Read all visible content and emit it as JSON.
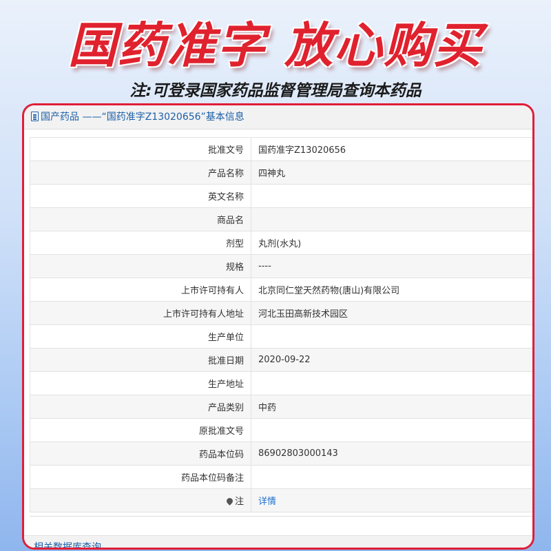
{
  "banner": {
    "title": "国药准字 放心购买",
    "notice": "注:可登录国家药品监督管理局查询本药品"
  },
  "panel": {
    "icon": "document-icon",
    "title": "国产药品 ——“国药准字Z13020656”基本信息",
    "rows": [
      {
        "label": "批准文号",
        "value": "国药准字Z13020656"
      },
      {
        "label": "产品名称",
        "value": "四神丸"
      },
      {
        "label": "英文名称",
        "value": ""
      },
      {
        "label": "商品名",
        "value": ""
      },
      {
        "label": "剂型",
        "value": "丸剂(水丸)"
      },
      {
        "label": "规格",
        "value": "----"
      },
      {
        "label": "上市许可持有人",
        "value": "北京同仁堂天然药物(唐山)有限公司"
      },
      {
        "label": "上市许可持有人地址",
        "value": "河北玉田高新技术园区"
      },
      {
        "label": "生产单位",
        "value": ""
      },
      {
        "label": "批准日期",
        "value": "2020-09-22"
      },
      {
        "label": "生产地址",
        "value": ""
      },
      {
        "label": "产品类别",
        "value": "中药"
      },
      {
        "label": "原批准文号",
        "value": ""
      },
      {
        "label": "药品本位码",
        "value": "86902803000143"
      },
      {
        "label": "药品本位码备注",
        "value": ""
      }
    ],
    "note_row": {
      "icon": "pin-icon",
      "label": "注",
      "link": "详情"
    },
    "footer": "相关数据库查询"
  },
  "colors": {
    "accent_red": "#e0222e",
    "border_red": "#e11d37",
    "link_blue": "#1b6fd0",
    "header_blue": "#1b5fa8"
  }
}
